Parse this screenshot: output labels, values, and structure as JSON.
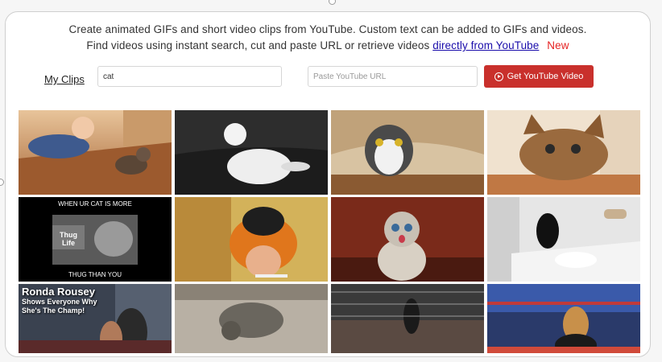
{
  "intro": {
    "line1": "Create animated GIFs and short video clips from YouTube. Custom text can be added to GIFs and videos.",
    "line2": "Find videos using instant search, cut and paste URL or retrieve videos",
    "link": "directly from YouTube",
    "new_badge": "New"
  },
  "nav": {
    "my_clips": "My Clips"
  },
  "search": {
    "value": "cat"
  },
  "url_field": {
    "placeholder": "Paste YouTube URL"
  },
  "get_button": {
    "label": "Get YouTube Video",
    "icon": "youtube-play-icon"
  },
  "colors": {
    "accent_red": "#c9302c",
    "link_blue": "#1a0dab",
    "new_red": "#e52222"
  },
  "thumbnails": [
    {
      "caption_top": ""
    },
    {
      "caption_top": ""
    },
    {
      "caption_top": ""
    },
    {
      "caption_top": ""
    },
    {
      "caption_top": "WHEN UR CAT IS MORE",
      "caption_mid": "Thug\nLife",
      "caption_bottom": "THUG THAN YOU"
    },
    {
      "caption_top": ""
    },
    {
      "caption_top": ""
    },
    {
      "caption_top": ""
    },
    {
      "title": "Ronda Rousey",
      "subtitle1": "Shows Everyone Why",
      "subtitle2": "She's The Champ!"
    },
    {
      "caption_top": ""
    },
    {
      "caption_top": ""
    },
    {
      "caption_top": ""
    }
  ]
}
